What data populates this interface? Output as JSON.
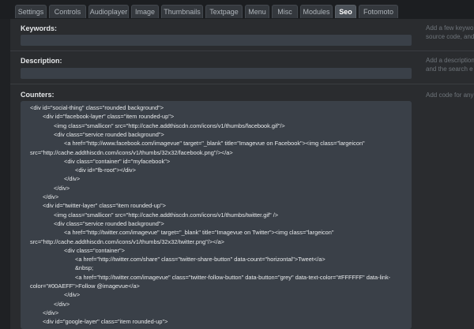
{
  "tabs": [
    {
      "label": "Settings",
      "active": false
    },
    {
      "label": "Controls",
      "active": false
    },
    {
      "label": "Audioplayer",
      "active": false
    },
    {
      "label": "Image",
      "active": false
    },
    {
      "label": "Thumbnails",
      "active": false
    },
    {
      "label": "Textpage",
      "active": false
    },
    {
      "label": "Menu",
      "active": false
    },
    {
      "label": "Misc",
      "active": false
    },
    {
      "label": "Modules",
      "active": false
    },
    {
      "label": "Seo",
      "active": true
    },
    {
      "label": "Fotomoto",
      "active": false
    }
  ],
  "keywords": {
    "label": "Keywords:",
    "value": "",
    "hint_lines": [
      "Add a few keywor",
      "source code, and"
    ]
  },
  "description": {
    "label": "Description:",
    "value": "",
    "hint_lines": [
      "Add a description",
      "and the search e"
    ]
  },
  "counters": {
    "label": "Counters:",
    "hint_lines": [
      "Add code for any"
    ],
    "code_lines": [
      {
        "indent": 0,
        "text": "<div id=\"social-thing\" class=\"rounded background\">"
      },
      {
        "indent": 1,
        "text": "<div id=\"facebook-layer\" class=\"item rounded-up\">"
      },
      {
        "indent": 2,
        "text": "<img class=\"smallicon\" src=\"http://cache.addthiscdn.com/icons/v1/thumbs/facebook.gif\"/>"
      },
      {
        "indent": 2,
        "text": "<div class=\"service rounded background\">"
      },
      {
        "indent": 3,
        "text": "<a href=\"http://www.facebook.com/imagevue\" target=\"_blank\" title=\"Imagevue on Facebook\"><img class=\"largeicon\""
      },
      {
        "indent": 0,
        "text": "src=\"http://cache.addthiscdn.com/icons/v1/thumbs/32x32/facebook.png\"/></a>"
      },
      {
        "indent": 3,
        "text": "<div class=\"container\" id=\"myfacebook\">"
      },
      {
        "indent": 4,
        "text": "<div id=\"fb-root\"></div>"
      },
      {
        "indent": 3,
        "text": "</div>"
      },
      {
        "indent": 2,
        "text": "</div>"
      },
      {
        "indent": 1,
        "text": "</div>"
      },
      {
        "indent": 1,
        "text": "<div id=\"twitter-layer\" class=\"item rounded-up\">"
      },
      {
        "indent": 2,
        "text": "<img class=\"smallicon\" src=\"http://cache.addthiscdn.com/icons/v1/thumbs/twitter.gif\" />"
      },
      {
        "indent": 2,
        "text": "<div class=\"service rounded background\">"
      },
      {
        "indent": 3,
        "text": "<a href=\"http://twitter.com/imagevue\" target=\"_blank\" title=\"Imagevue on Twitter\"><img class=\"largeicon\""
      },
      {
        "indent": 0,
        "text": "src=\"http://cache.addthiscdn.com/icons/v1/thumbs/32x32/twitter.png\"/></a>"
      },
      {
        "indent": 3,
        "text": "<div class=\"container\">"
      },
      {
        "indent": 4,
        "text": "<a href=\"http://twitter.com/share\" class=\"twitter-share-button\" data-count=\"horizontal\">Tweet</a>"
      },
      {
        "indent": 4,
        "text": "&nbsp;"
      },
      {
        "indent": 4,
        "text": "<a href=\"http://twitter.com/imagevue\" class=\"twitter-follow-button\" data-button=\"grey\" data-text-color=\"#FFFFFF\" data-link-"
      },
      {
        "indent": 0,
        "text": "color=\"#00AEFF\">Follow @imagevue</a>"
      },
      {
        "indent": 3,
        "text": "</div>"
      },
      {
        "indent": 2,
        "text": "</div>"
      },
      {
        "indent": 1,
        "text": "</div>"
      },
      {
        "indent": 1,
        "text": "<div id=\"google-layer\" class=\"item rounded-up\">"
      }
    ]
  }
}
